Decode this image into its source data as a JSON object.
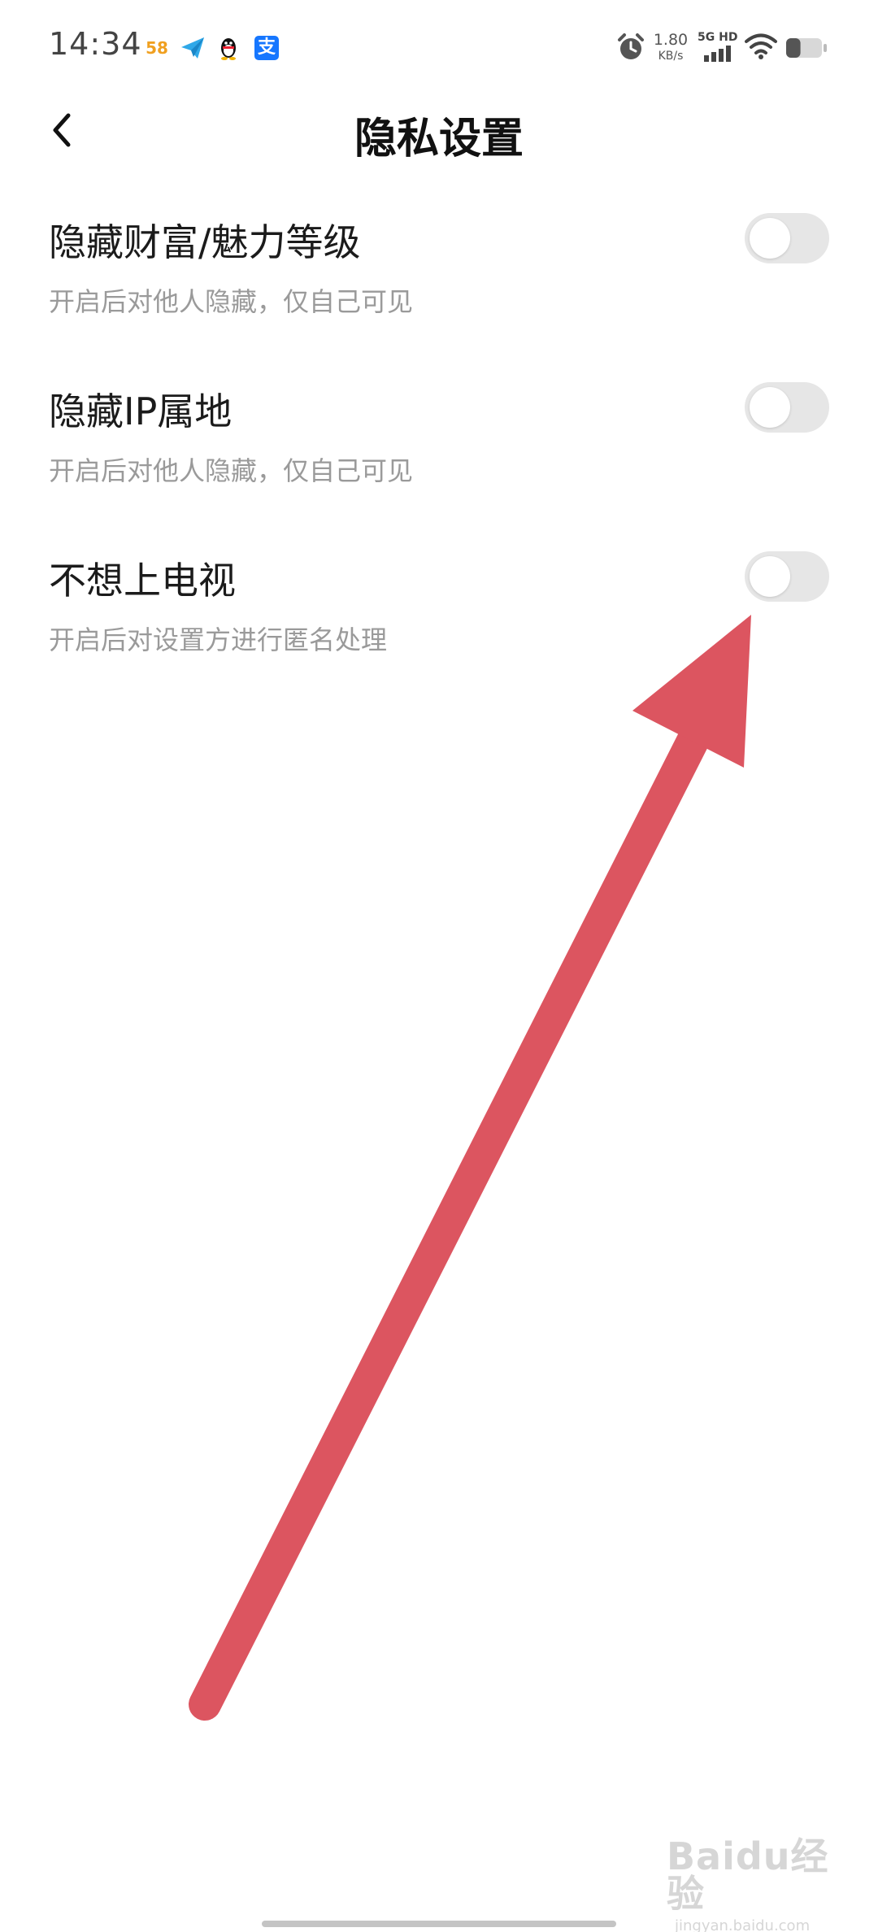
{
  "status_bar": {
    "time": "14:34",
    "notification_icons": [
      "58-app-icon",
      "paper-plane-icon",
      "qq-penguin-icon",
      "alipay-icon"
    ],
    "app58_text": "58",
    "alipay_text": "支",
    "net_speed": "1.80",
    "net_speed_unit": "KB/s",
    "network_label": "5G HD",
    "battery_level": 0.4
  },
  "header": {
    "title": "隐私设置",
    "back_icon": "chevron-left-icon"
  },
  "settings": [
    {
      "label": "隐藏财富/魅力等级",
      "description": "开启后对他人隐藏，仅自己可见",
      "enabled": false
    },
    {
      "label": "隐藏IP属地",
      "description": "开启后对他人隐藏，仅自己可见",
      "enabled": false
    },
    {
      "label": "不想上电视",
      "description": "开启后对设置方进行匿名处理",
      "enabled": false
    }
  ],
  "annotation": {
    "arrow_color": "#dc5560"
  },
  "watermark": {
    "logo": "Baidu经验",
    "site": "jingyan.baidu.com"
  },
  "colors": {
    "toggle_off": "#e6e6e6",
    "description_text": "#9a9a9a"
  }
}
